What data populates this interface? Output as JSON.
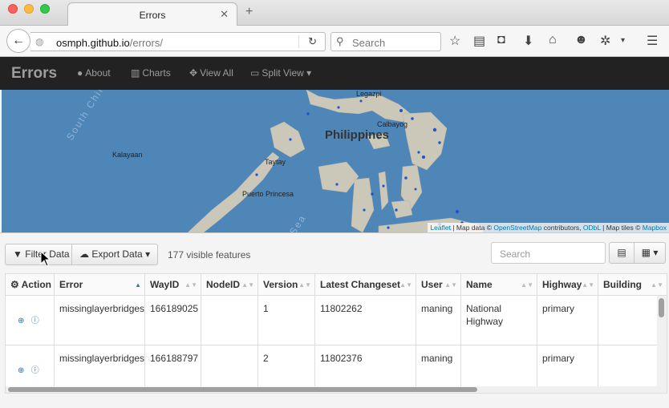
{
  "browser": {
    "tab_title": "Errors",
    "url_host": "osmph.github.io",
    "url_path": "/errors/",
    "search_placeholder": "Search"
  },
  "app": {
    "brand": "Errors",
    "nav": {
      "about": "About",
      "charts": "Charts",
      "view_all": "View All",
      "split_view": "Split View"
    }
  },
  "map": {
    "labels": {
      "legazpi": "Legazpi",
      "philippines": "Philippines",
      "calbayog": "Calbayog",
      "kalayaan": "Kalayaan",
      "taytay": "Taytay",
      "puerto_princesa": "Puerto Princesa",
      "south_china_sea": "South China Sea",
      "sulu_sea": "Sea"
    },
    "attribution": {
      "leaflet": "Leaflet",
      "map_data": "Map data ©",
      "osm": "OpenStreetMap",
      "contributors": "contributors,",
      "odbl": "ODbL",
      "tiles": "Map tiles ©",
      "mapbox": "Mapbox"
    },
    "colors": {
      "water": "#4f86b8",
      "land": "#cbc8ba",
      "error_dot": "#2254c8"
    }
  },
  "toolbar": {
    "filter_data": "Filter Data",
    "export_data": "Export Data",
    "visible_count": "177 visible features",
    "search_placeholder": "Search"
  },
  "table": {
    "columns": [
      "Action",
      "Error",
      "WayID",
      "NodeID",
      "Version",
      "Latest Changeset",
      "User",
      "Name",
      "Highway",
      "Building"
    ],
    "rows": [
      {
        "error": "missinglayerbridges",
        "wayid": "166189025",
        "nodeid": "",
        "version": "1",
        "changeset": "11802262",
        "user": "maning",
        "name": "National Highway",
        "highway": "primary",
        "building": ""
      },
      {
        "error": "missinglayerbridges",
        "wayid": "166188797",
        "nodeid": "",
        "version": "2",
        "changeset": "11802376",
        "user": "maning",
        "name": "",
        "highway": "primary",
        "building": ""
      }
    ]
  }
}
